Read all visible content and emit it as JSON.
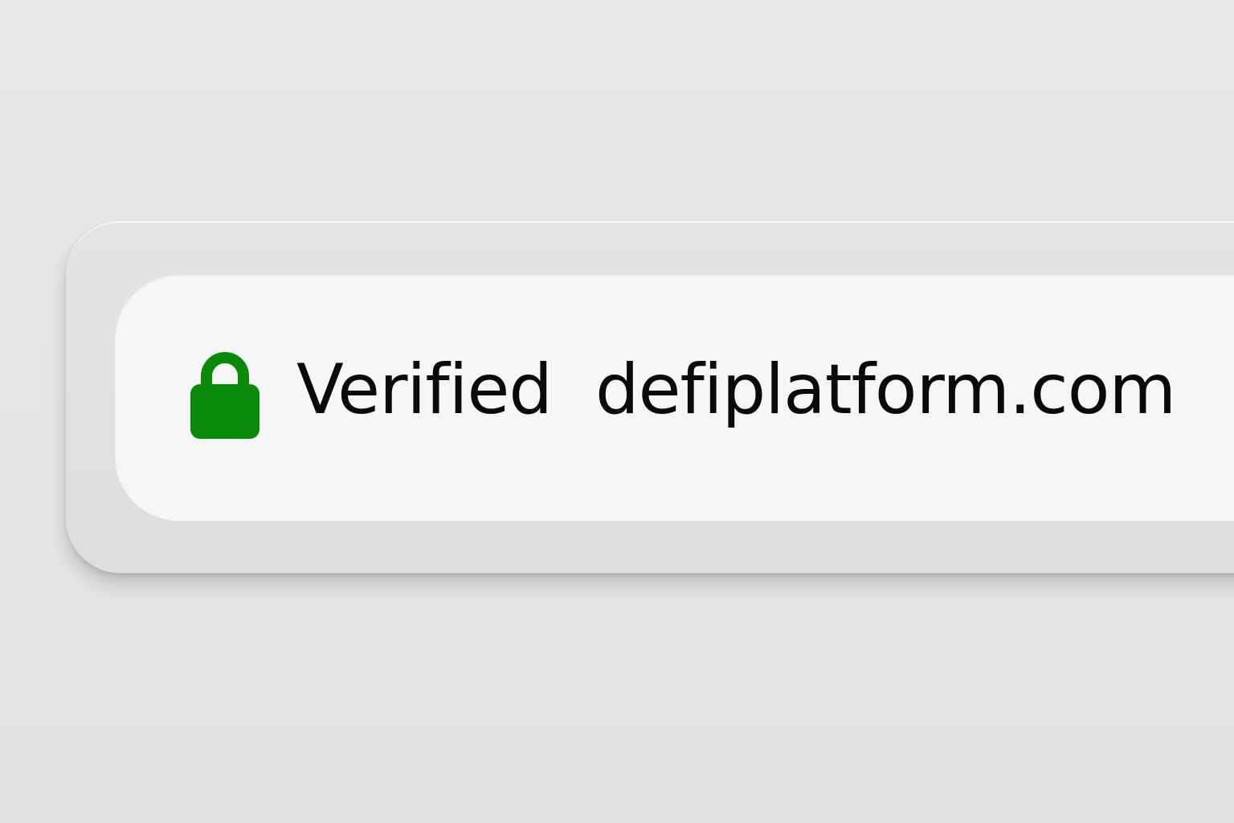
{
  "address_bar": {
    "security_label": "Verified",
    "url": "defiplatform.com",
    "lock_icon": "lock-icon",
    "lock_color": "#0a8a0a",
    "text_color": "#0a0a0a"
  }
}
